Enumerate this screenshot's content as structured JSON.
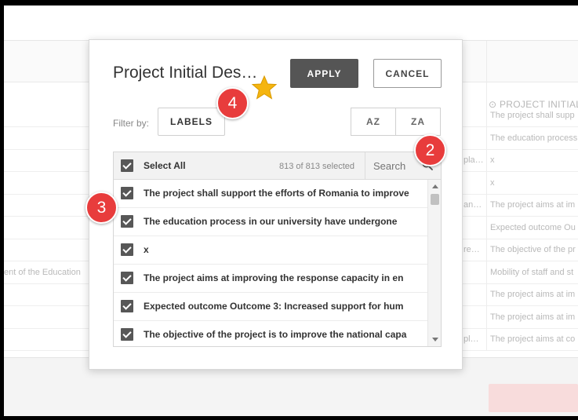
{
  "background": {
    "column_header": "⊙ PROJECT INITIAL",
    "rows": [
      {
        "right": "The project shall supp",
        "mid": "",
        "left": ""
      },
      {
        "right": "The education process",
        "mid": "",
        "left": ""
      },
      {
        "right": "x",
        "mid": "pla…",
        "left": ""
      },
      {
        "right": "x",
        "mid": "",
        "left": ""
      },
      {
        "right": "The project aims at im",
        "mid": "an…",
        "left": ""
      },
      {
        "right": "Expected outcome Ou",
        "mid": "",
        "left": ""
      },
      {
        "right": "The objective of the pr",
        "mid": "re…",
        "left": ""
      },
      {
        "right": "Mobility of staff and st",
        "mid": "",
        "left": "ent of the Education"
      },
      {
        "right": "The project aims at im",
        "mid": "",
        "left": ""
      },
      {
        "right": "The project aims at im",
        "mid": "",
        "left": ""
      },
      {
        "right": "The project aims at co",
        "mid": "pl…",
        "left": ""
      }
    ]
  },
  "modal": {
    "title": "Project Initial Des…",
    "apply_label": "APPLY",
    "cancel_label": "CANCEL",
    "filter_label": "Filter by:",
    "labels_button": "LABELS",
    "az_button": "AZ",
    "za_button": "ZA",
    "list": {
      "select_all_label": "Select All",
      "selected_count": "813 of 813 selected",
      "search_placeholder": "Search",
      "items": [
        {
          "label": "The project shall support the efforts of Romania to improve",
          "checked": true
        },
        {
          "label": "The education process in our university have undergone",
          "checked": true
        },
        {
          "label": "x",
          "checked": true
        },
        {
          "label": "The project aims at improving the response capacity in en",
          "checked": true
        },
        {
          "label": "Expected outcome Outcome 3: Increased support for hum",
          "checked": true
        },
        {
          "label": "The objective of the project is to improve the national capa",
          "checked": true
        }
      ]
    }
  },
  "annotations": {
    "badge_2": "2",
    "badge_3": "3",
    "badge_4": "4",
    "star_icon": "star-icon"
  },
  "colors": {
    "badge": "#e83c3c",
    "apply_button": "#555555",
    "checkbox": "#575757",
    "star": "#f5b50f"
  }
}
